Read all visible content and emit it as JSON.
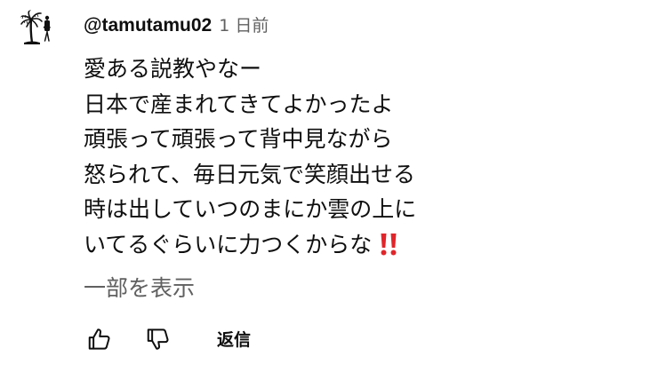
{
  "comment": {
    "author": "@tamutamu02",
    "time": "1 日前",
    "lines": [
      "愛ある説教やなー",
      "日本で産まれてきてよかったよ",
      "頑張って頑張って背中見ながら",
      "怒られて、毎日元気で笑顔出せる",
      "時は出していつのまにか雲の上に",
      "いてるぐらいに力つくからな"
    ],
    "trailing_emoji": "double-exclamation-icon",
    "show_more_label": "一部を表示"
  },
  "actions": {
    "like_icon": "thumbs-up-icon",
    "dislike_icon": "thumbs-down-icon",
    "reply_label": "返信"
  },
  "colors": {
    "text_primary": "#0f0f0f",
    "text_secondary": "#606060",
    "emoji_red": "#e0262b",
    "background": "#ffffff"
  }
}
